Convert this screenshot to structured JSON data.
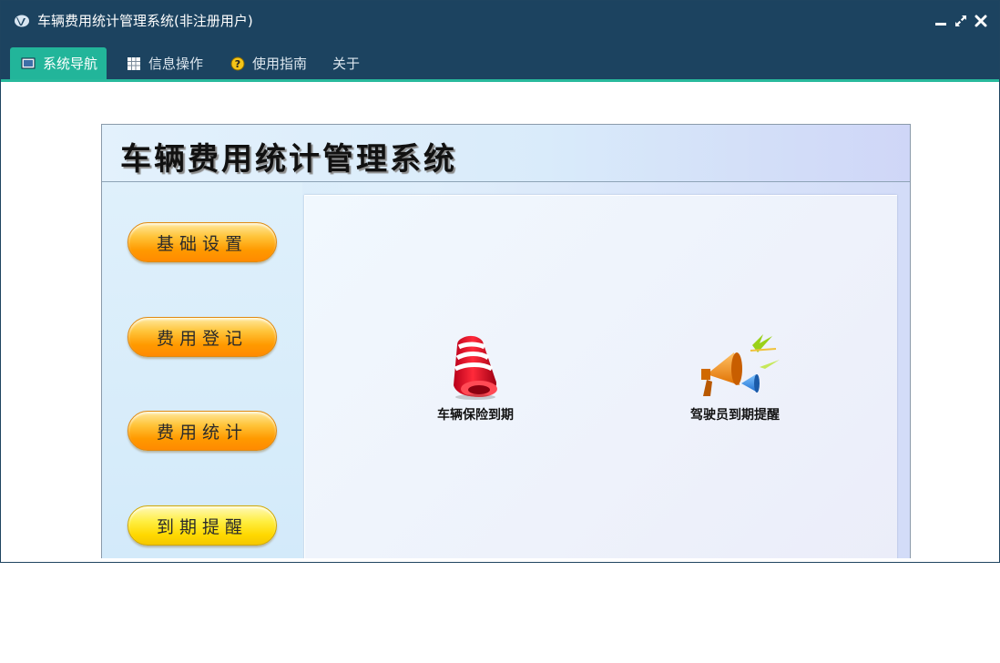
{
  "window": {
    "title": "车辆费用统计管理系统(非注册用户)",
    "controls": [
      "minimize-icon",
      "restore-icon",
      "close-icon"
    ]
  },
  "menu": {
    "tabs": [
      {
        "label": "系统导航",
        "icon": "monitor-icon",
        "active": true
      },
      {
        "label": "信息操作",
        "icon": "grid-icon",
        "active": false
      },
      {
        "label": "使用指南",
        "icon": "help-icon",
        "active": false
      },
      {
        "label": "关于",
        "icon": "",
        "active": false
      }
    ]
  },
  "app": {
    "banner_title": "车辆费用统计管理系统",
    "side_buttons": [
      "基础设置",
      "费用登记",
      "费用统计",
      "到期提醒"
    ],
    "tiles": [
      {
        "label": "车辆保险到期",
        "icon": "alarm-bell-icon"
      },
      {
        "label": "驾驶员到期提醒",
        "icon": "megaphone-icon"
      }
    ]
  },
  "colors": {
    "titlebar": "#1c4360",
    "active_tab": "#22b59a",
    "accent_line": "#28b99c",
    "orange_button": "#ff9a00",
    "yellow_button": "#ffe000"
  }
}
